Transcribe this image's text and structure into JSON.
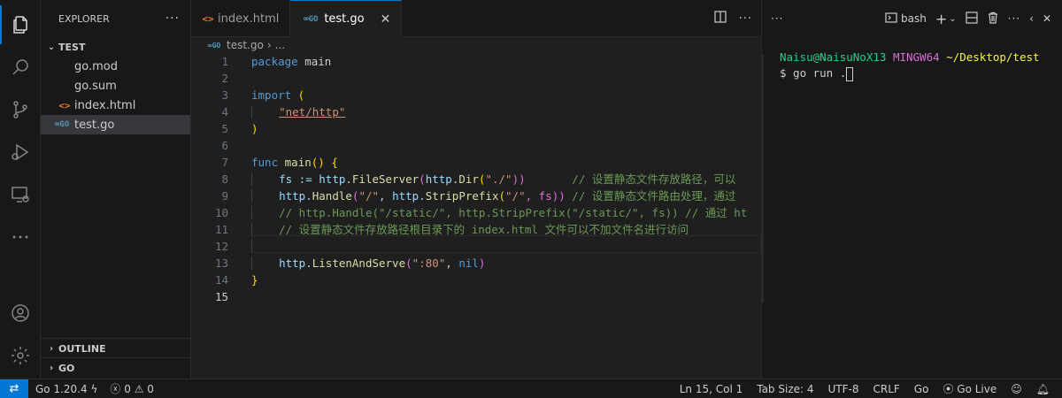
{
  "explorer": {
    "title": "EXPLORER",
    "folder": "TEST",
    "files": [
      {
        "name": "go.mod",
        "type": "mod"
      },
      {
        "name": "go.sum",
        "type": "sum"
      },
      {
        "name": "index.html",
        "type": "html"
      },
      {
        "name": "test.go",
        "type": "go"
      }
    ],
    "sections": {
      "outline": "OUTLINE",
      "go": "GO"
    }
  },
  "tabs": [
    {
      "label": "index.html",
      "icon": "html-file-icon",
      "active": false
    },
    {
      "label": "test.go",
      "icon": "go-file-icon",
      "active": true
    }
  ],
  "breadcrumb": {
    "file": "test.go",
    "more": "..."
  },
  "editor": {
    "current_line": 15,
    "line_numbers": [
      "1",
      "2",
      "3",
      "4",
      "5",
      "6",
      "7",
      "8",
      "9",
      "10",
      "11",
      "12",
      "13",
      "14",
      "15"
    ],
    "lines": {
      "l1_kw": "package",
      "l1_rest": " main",
      "l3_kw": "import",
      "l3_rest": " (",
      "l4_str": "\"net/http\"",
      "l5": ")",
      "l7_kw": "func",
      "l7_fn": "main",
      "l7_rest": "() {",
      "l8_a": "fs := ",
      "l8_pkg": "http",
      "l8_b": ".",
      "l8_fn": "FileServer",
      "l8_c": "(",
      "l8_pkg2": "http",
      "l8_d": ".",
      "l8_fn2": "Dir",
      "l8_e": "(",
      "l8_str": "\"./\"",
      "l8_f": "))       ",
      "l8_cm": "// 设置静态文件存放路径，可以",
      "l9_a": "http.",
      "l9_fn": "Handle",
      "l9_b": "(",
      "l9_str": "\"/\"",
      "l9_c": ", http.",
      "l9_fn2": "StripPrefix",
      "l9_d": "(",
      "l9_str2": "\"/\"",
      "l9_e": ", fs)) ",
      "l9_cm": "// 设置静态文件路由处理，通过",
      "l10_cm": "// http.Handle(\"/static/\", http.StripPrefix(\"/static/\", fs)) // 通过 ht",
      "l11_cm": "// 设置静态文件存放路径根目录下的 index.html 文件可以不加文件名进行访问",
      "l13_a": "http.",
      "l13_fn": "ListenAndServe",
      "l13_b": "(",
      "l13_str": "\":80\"",
      "l13_c": ", ",
      "l13_nil": "nil",
      "l13_d": ")",
      "l14": "}"
    }
  },
  "terminal": {
    "shell": "bash",
    "user": "Naisu@NaisuNoX13",
    "system": "MINGW64",
    "path": "~/Desktop/test",
    "command": "$ go run ."
  },
  "statusbar": {
    "go_version": "Go 1.20.4",
    "errors": "0",
    "warnings": "0",
    "position": "Ln 15, Col 1",
    "tab_size": "Tab Size: 4",
    "encoding": "UTF-8",
    "eol": "CRLF",
    "language": "Go",
    "go_live": "Go Live"
  },
  "colors": {
    "accent": "#0078d4",
    "keyword": "#569cd6",
    "string": "#ce9178",
    "function": "#dcdcaa",
    "comment": "#6a9955"
  }
}
